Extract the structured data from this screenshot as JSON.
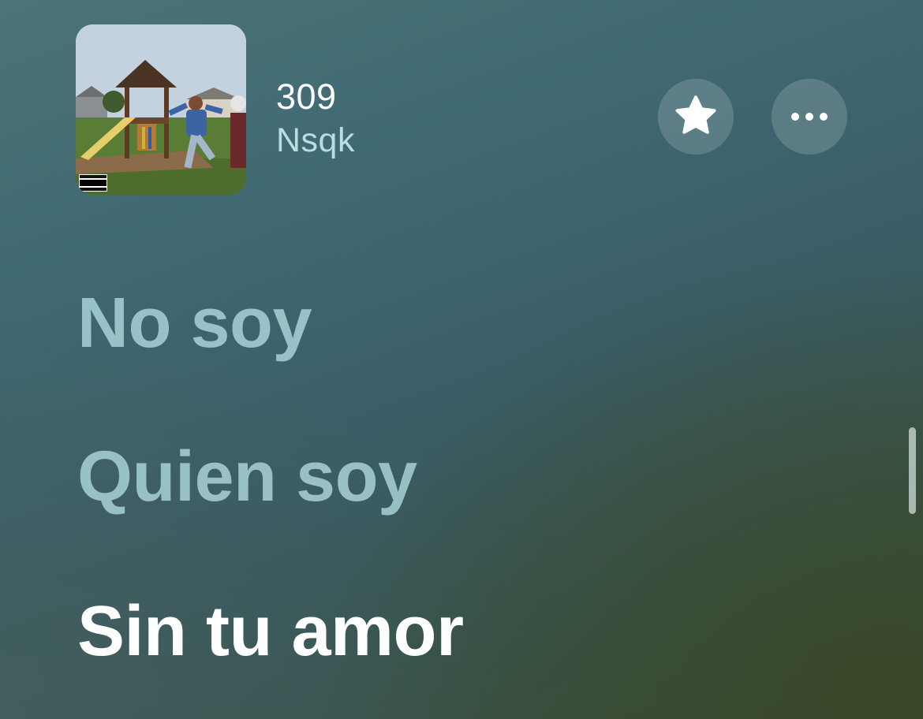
{
  "now_playing": {
    "title": "309",
    "artist": "Nsqk",
    "artwork_badge": [
      "PARENTAL",
      "ADVISORY",
      "EXPLICIT CONTENT"
    ]
  },
  "actions": {
    "favorite_icon": "star-icon",
    "more_icon": "ellipsis-icon"
  },
  "lyrics": {
    "lines": [
      {
        "text": "No soy",
        "state": "past"
      },
      {
        "text": "Quien soy",
        "state": "past"
      },
      {
        "text": "Sin tu amor",
        "state": "current"
      }
    ]
  },
  "colors": {
    "past_lyric": "#b2dce2",
    "current_lyric": "#ffffff",
    "artist_text": "#b9dde2"
  }
}
